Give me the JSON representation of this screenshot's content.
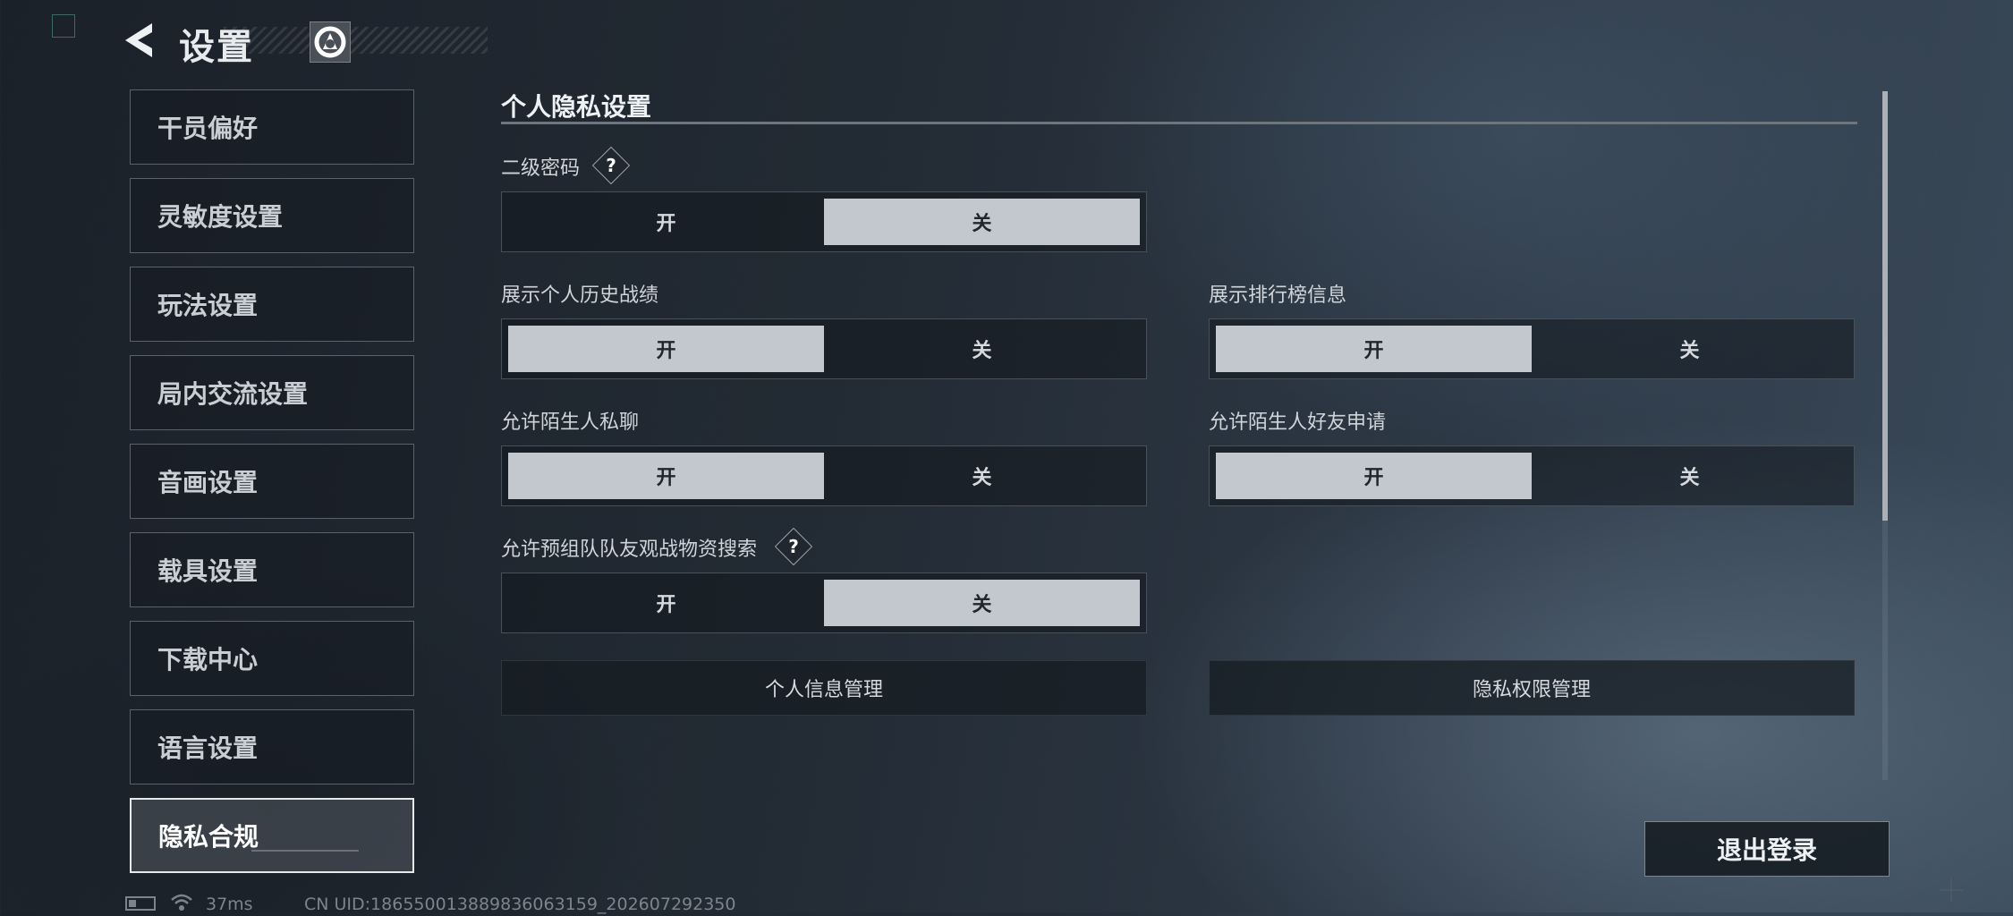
{
  "header": {
    "title": "设置"
  },
  "sidebar": {
    "items": [
      {
        "label": "干员偏好"
      },
      {
        "label": "灵敏度设置"
      },
      {
        "label": "玩法设置"
      },
      {
        "label": "局内交流设置"
      },
      {
        "label": "音画设置"
      },
      {
        "label": "载具设置"
      },
      {
        "label": "下载中心"
      },
      {
        "label": "语言设置"
      },
      {
        "label": "隐私合规",
        "active": true
      }
    ]
  },
  "main": {
    "section_title": "个人隐私设置",
    "toggle_on_label": "开",
    "toggle_off_label": "关",
    "settings": [
      {
        "label": "二级密码",
        "value": "关",
        "has_help": true
      },
      {
        "label": "展示个人历史战绩",
        "value": "开"
      },
      {
        "label": "展示排行榜信息",
        "value": "开"
      },
      {
        "label": "允许陌生人私聊",
        "value": "开"
      },
      {
        "label": "允许陌生人好友申请",
        "value": "开"
      },
      {
        "label": "允许预组队队友观战物资搜索",
        "value": "关",
        "has_help": true
      }
    ],
    "help_glyph": "?",
    "buttons": {
      "personal_info": "个人信息管理",
      "privacy_permissions": "隐私权限管理"
    }
  },
  "footer": {
    "logout_label": "退出登录",
    "ping": "37ms",
    "uid": "CN UID:186550013889836063159_202607292350"
  },
  "icons": {
    "back": "back-arrow-icon",
    "logo": "game-logo-icon",
    "battery": "battery-icon",
    "wifi": "wifi-icon",
    "help": "help-icon"
  },
  "colors": {
    "selected_option": "#c3c8ce",
    "background": "#222a33",
    "text": "#d7dbe0"
  }
}
